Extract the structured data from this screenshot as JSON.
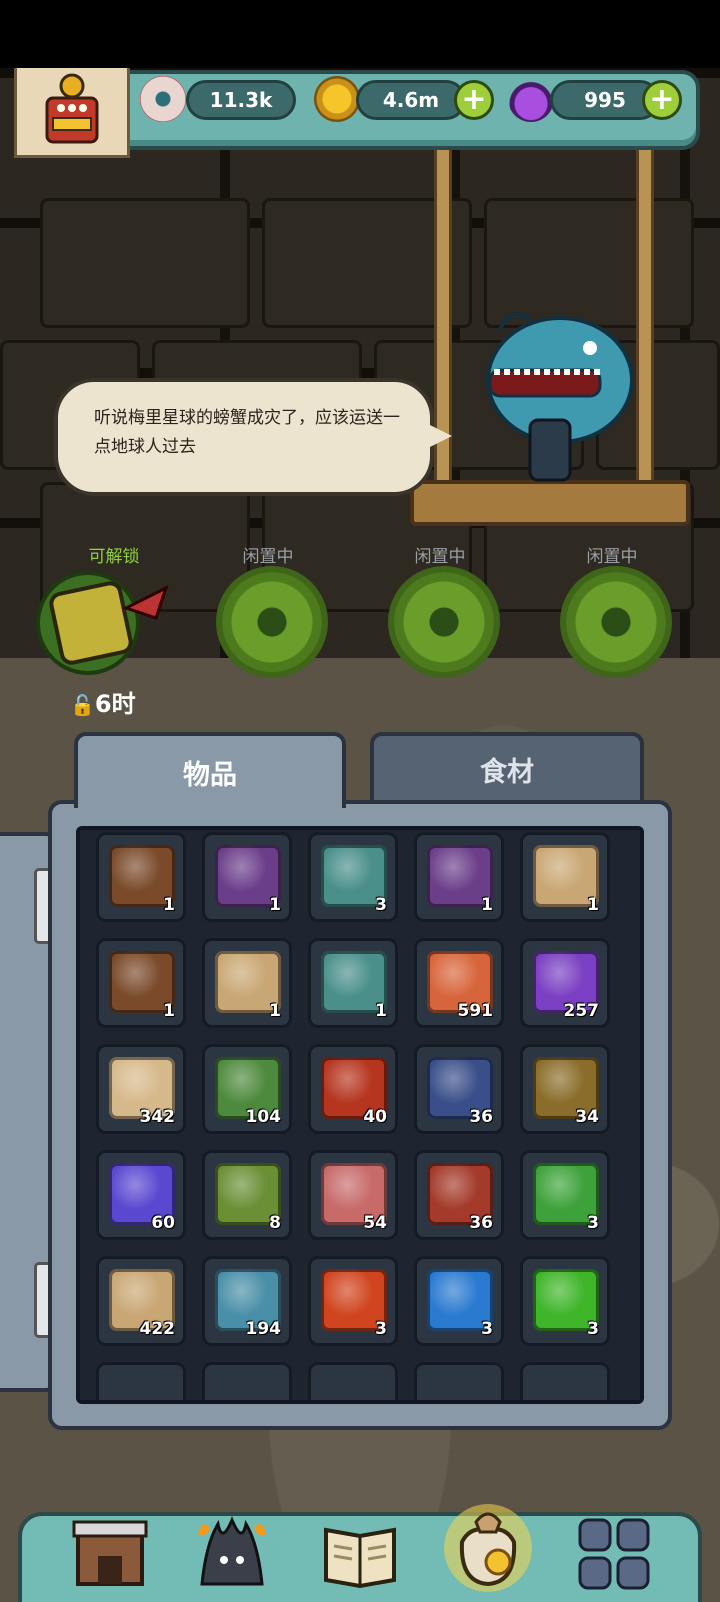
{
  "hud": {
    "eyes": {
      "value": "11.3k",
      "icon": "eyeball-icon"
    },
    "coins": {
      "value": "4.6m",
      "icon": "coin-icon"
    },
    "potions": {
      "value": "995",
      "icon": "potion-icon"
    },
    "plus": "+"
  },
  "speech": {
    "text": "听说梅里星球的螃蟹成灾了，应该运送一点地球人过去"
  },
  "slots": [
    {
      "label": "可解锁",
      "timer": "6时",
      "state": "unlockable",
      "color": "#8fd13f"
    },
    {
      "label": "闲置中",
      "state": "idle",
      "color": "#9aa0a6"
    },
    {
      "label": "闲置中",
      "state": "idle",
      "color": "#9aa0a6"
    },
    {
      "label": "闲置中",
      "state": "idle",
      "color": "#9aa0a6"
    }
  ],
  "tabs": [
    {
      "label": "物品",
      "active": true
    },
    {
      "label": "食材",
      "active": false
    }
  ],
  "inventory": [
    {
      "icon": "leather-book-icon",
      "count": "1",
      "color": "#7a4a2a"
    },
    {
      "icon": "purple-chest-icon",
      "count": "1",
      "color": "#6b3e8a"
    },
    {
      "icon": "bottle-icon",
      "count": "3",
      "color": "#4a8f8a"
    },
    {
      "icon": "purple-chest-icon",
      "count": "1",
      "color": "#6b3e8a"
    },
    {
      "icon": "map-scroll-icon",
      "count": "1",
      "color": "#c9a774"
    },
    {
      "icon": "leather-book-icon",
      "count": "1",
      "color": "#7a4a2a"
    },
    {
      "icon": "map-scroll-icon",
      "count": "1",
      "color": "#c9a774"
    },
    {
      "icon": "bottle-icon",
      "count": "1",
      "color": "#4a8f8a"
    },
    {
      "icon": "meat-bone-icon",
      "count": "591",
      "color": "#d7653b"
    },
    {
      "icon": "purple-powder-icon",
      "count": "257",
      "color": "#7a3fc2"
    },
    {
      "icon": "parchment-icon",
      "count": "342",
      "color": "#d6b98a"
    },
    {
      "icon": "card-pack-icon",
      "count": "104",
      "color": "#4e8a3e"
    },
    {
      "icon": "oil-barrel-icon",
      "count": "40",
      "color": "#b5351f"
    },
    {
      "icon": "monster-card-icon",
      "count": "36",
      "color": "#3a4f8a"
    },
    {
      "icon": "cauldron-card-icon",
      "count": "34",
      "color": "#8a6d2a"
    },
    {
      "icon": "crystal-cluster-icon",
      "count": "60",
      "color": "#5a48d0"
    },
    {
      "icon": "slime-rock-icon",
      "count": "8",
      "color": "#6a8f35"
    },
    {
      "icon": "scroll-map-icon",
      "count": "54",
      "color": "#c86a6a"
    },
    {
      "icon": "machine-card-icon",
      "count": "36",
      "color": "#a33a2a"
    },
    {
      "icon": "clover-icon",
      "count": "3",
      "color": "#3ea23a"
    },
    {
      "icon": "furball-jar-icon",
      "count": "422",
      "color": "#c9a774"
    },
    {
      "icon": "furball-gear-icon",
      "count": "194",
      "color": "#4a8fa8"
    },
    {
      "icon": "red-gem-icon",
      "count": "3",
      "color": "#d0451f"
    },
    {
      "icon": "blue-gem-icon",
      "count": "3",
      "color": "#2a7ad0"
    },
    {
      "icon": "green-gem-icon",
      "count": "3",
      "color": "#3fb52a"
    }
  ],
  "nav": [
    {
      "icon": "shop-icon"
    },
    {
      "icon": "campfire-monster-icon"
    },
    {
      "icon": "book-icon"
    },
    {
      "icon": "money-bag-icon"
    },
    {
      "icon": "grid-menu-icon"
    }
  ]
}
